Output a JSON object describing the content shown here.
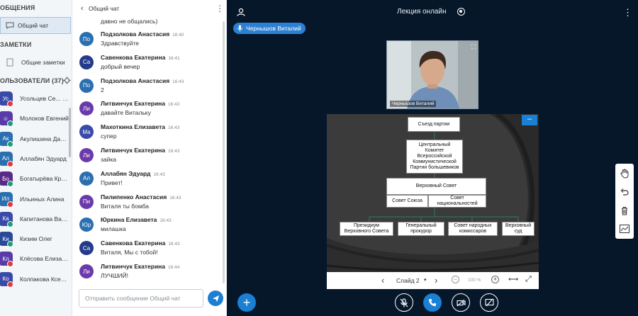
{
  "sidebar": {
    "messages_title": "ОБЩЕНИЯ",
    "public_chat": "Общий чат",
    "notes_title": "ЗАМЕТКИ",
    "shared_notes": "Общие заметки",
    "users_title": "ОЛЬЗОВАТЕЛИ (37)",
    "users": [
      {
        "initials": "Ус",
        "name": "Усольцев Се...",
        "suffix": "(Вы)",
        "color": "#3a4aa8",
        "badge": "#e0383e"
      },
      {
        "initials": "☺",
        "name": "Молоков Евгений",
        "suffix": "",
        "color": "#5a3aa8",
        "badge": "#1a9e7a"
      },
      {
        "initials": "Ак",
        "name": "Акулишина Дарья",
        "suffix": "",
        "color": "#2a6fb0",
        "badge": "#1a9e7a"
      },
      {
        "initials": "Ал",
        "name": "Аллабян Эдуард",
        "suffix": "",
        "color": "#2a6fb0",
        "badge": "#e0383e"
      },
      {
        "initials": "Бо",
        "name": "Богатырёва Крис...",
        "suffix": "",
        "color": "#5a2a8a",
        "badge": "#1a9e7a"
      },
      {
        "initials": "Ил",
        "name": "Ильиных Алина",
        "suffix": "",
        "color": "#2a6fb0",
        "badge": "#e0383e"
      },
      {
        "initials": "Ка",
        "name": "Капитанова Вале...",
        "suffix": "",
        "color": "#3a4aa8",
        "badge": "#1a9e7a"
      },
      {
        "initials": "Ки",
        "name": "Кизим Олег",
        "suffix": "",
        "color": "#2a4a98",
        "badge": "#1a9e7a"
      },
      {
        "initials": "Кл",
        "name": "Клёсова Елизавета",
        "suffix": "",
        "color": "#5a3aa8",
        "badge": "#e0383e"
      },
      {
        "initials": "Ко",
        "name": "Колпакова Ксения",
        "suffix": "",
        "color": "#3a4aa8",
        "badge": "#e0383e"
      }
    ]
  },
  "chat": {
    "title": "Общий чат",
    "partial_top": "давно не общались)",
    "messages": [
      {
        "initials": "По",
        "name": "Подзолкова Анастасия",
        "time": "16:40",
        "text": "Здравствуйте",
        "color": "#2a6fb0"
      },
      {
        "initials": "Са",
        "name": "Савенкова Екатерина",
        "time": "16:41",
        "text": "добрый вечер",
        "color": "#243a8a"
      },
      {
        "initials": "По",
        "name": "Подзолкова Анастасия",
        "time": "16:43",
        "text": "2",
        "color": "#2a6fb0"
      },
      {
        "initials": "Ли",
        "name": "Литвинчук Екатерина",
        "time": "16:43",
        "text": "давайте Витальку",
        "color": "#6a3aaa"
      },
      {
        "initials": "Ма",
        "name": "Махоткина Елизавета",
        "time": "16:43",
        "text": "супер",
        "color": "#3a4aa8"
      },
      {
        "initials": "Ли",
        "name": "Литвинчук Екатерина",
        "time": "16:43",
        "text": "зайка",
        "color": "#6a3aaa"
      },
      {
        "initials": "Ал",
        "name": "Аллабян Эдуард",
        "time": "16:43",
        "text": "Привет!",
        "color": "#2a6fb0"
      },
      {
        "initials": "Пи",
        "name": "Пилипенко Анастасия",
        "time": "16:43",
        "text": "Виталя ты бомба",
        "color": "#6a3aaa"
      },
      {
        "initials": "Юр",
        "name": "Юркина Елизавета",
        "time": "16:43",
        "text": "милашка",
        "color": "#2a6fb0"
      },
      {
        "initials": "Са",
        "name": "Савенкова Екатерина",
        "time": "16:43",
        "text": "Виталя, Мы с тобой!",
        "color": "#243a8a"
      },
      {
        "initials": "Ли",
        "name": "Литвинчук Екатерина",
        "time": "16:44",
        "text": "ЛУЧШИЙ!",
        "color": "#6a3aaa"
      }
    ],
    "input_placeholder": "Отправить сообщение Общий чат"
  },
  "main": {
    "title": "Лекция онлайн",
    "talker": "Чернышов Виталий",
    "webcam_label": "Чернышов Виталий",
    "slide": {
      "boxes": {
        "congress": "Съезд партии",
        "central_committee": "Центральный Комитет Всероссийской Коммунистической Партии большевиков",
        "supreme_soviet": "Верховный Совет",
        "soviet_union": "Совет Союза",
        "soviet_nationalities": "Совет национальностей",
        "presidium": "Президиум Верховного Совета",
        "prosecutor": "Генеральный прокурор",
        "commissars": "Совет народных комиссаров",
        "court": "Верховный суд"
      },
      "slide_label": "Слайд 2",
      "zoom": "100 %"
    }
  }
}
